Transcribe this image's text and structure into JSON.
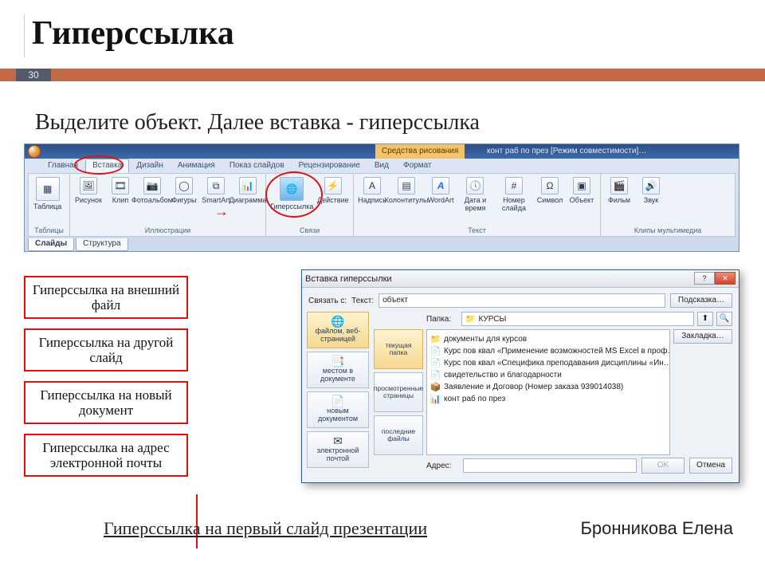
{
  "page": {
    "title": "Гиперссылка",
    "number": "30",
    "instruction": "Выделите объект. Далее вставка - гиперссылка"
  },
  "ribbon": {
    "context_label": "Средства рисования",
    "doc_title": "конт раб по през [Режим совместимости]…",
    "tabs": [
      "Главная",
      "Вставка",
      "Дизайн",
      "Анимация",
      "Показ слайдов",
      "Рецензирование",
      "Вид",
      "Формат"
    ],
    "active_tab": 1,
    "groups": {
      "tables": {
        "label": "Таблицы",
        "items": [
          "Таблица"
        ]
      },
      "illustrations": {
        "label": "Иллюстрации",
        "items": [
          "Рисунок",
          "Клип",
          "Фотоальбом",
          "Фигуры",
          "SmartArt",
          "Диаграмма"
        ]
      },
      "links": {
        "label": "Связи",
        "items": [
          "Гиперссылка",
          "Действие"
        ]
      },
      "text": {
        "label": "Текст",
        "items": [
          "Надпись",
          "Колонтитулы",
          "WordArt",
          "Дата и время",
          "Номер слайда",
          "Символ",
          "Объект"
        ]
      },
      "media": {
        "label": "Клипы мультимедиа",
        "items": [
          "Фильм",
          "Звук"
        ]
      }
    },
    "panel_tabs": [
      "Слайды",
      "Структура"
    ]
  },
  "boxes": {
    "b1": "Гиперссылка на внешний файл",
    "b2": "Гиперссылка на другой слайд",
    "b3": "Гиперссылка на новый документ",
    "b4": "Гиперссылка на адрес электронной почты"
  },
  "dialog": {
    "title": "Вставка гиперссылки",
    "link_to_label": "Связать с:",
    "text_label": "Текст:",
    "text_value": "объект",
    "hint_btn": "Подсказка…",
    "left_items": [
      "файлом, веб-страницей",
      "местом в документе",
      "новым документом",
      "электронной почтой"
    ],
    "folder_label": "Папка:",
    "folder_value": "КУРСЫ",
    "subnav": [
      "текущая папка",
      "просмотренные страницы",
      "последние файлы"
    ],
    "files": [
      {
        "icon": "📁",
        "name": "документы для курсов"
      },
      {
        "icon": "📄",
        "name": "Курс пов квал «Применение возможностей MS Excel в проф…"
      },
      {
        "icon": "📄",
        "name": "Курс пов квал «Специфика преподавания дисциплины «Ин…"
      },
      {
        "icon": "📄",
        "name": "свидетельство и благодарности"
      },
      {
        "icon": "📦",
        "name": "Заявление и Договор (Номер заказа 939014038)"
      },
      {
        "icon": "📊",
        "name": "конт раб по през"
      }
    ],
    "bookmark_btn": "Закладка…",
    "address_label": "Адрес:",
    "ok": "OK",
    "cancel": "Отмена"
  },
  "link_text": "Гиперссылка на первый слайд презентации",
  "author": "Бронникова Елена"
}
